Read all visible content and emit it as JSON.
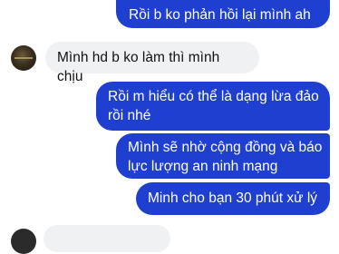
{
  "messages": [
    {
      "from": "me",
      "text": "Rồi b ko phản hồi lại mình ah ?"
    },
    {
      "from": "them",
      "text": "Mình hd b ko làm thì mình chịu"
    },
    {
      "from": "me",
      "line1": "Rồi m hiểu có thể là dạng lừa đảo",
      "line2": "rồi nhé"
    },
    {
      "from": "me",
      "line1": "Mình sẽ nhờ cộng đồng và báo",
      "line2": "lực lượng an ninh mạng"
    },
    {
      "from": "me",
      "text": "Minh cho bạn 30 phút xử lý"
    }
  ],
  "colors": {
    "outgoing": "#1e3fcf",
    "incoming": "#f0f1f3"
  }
}
